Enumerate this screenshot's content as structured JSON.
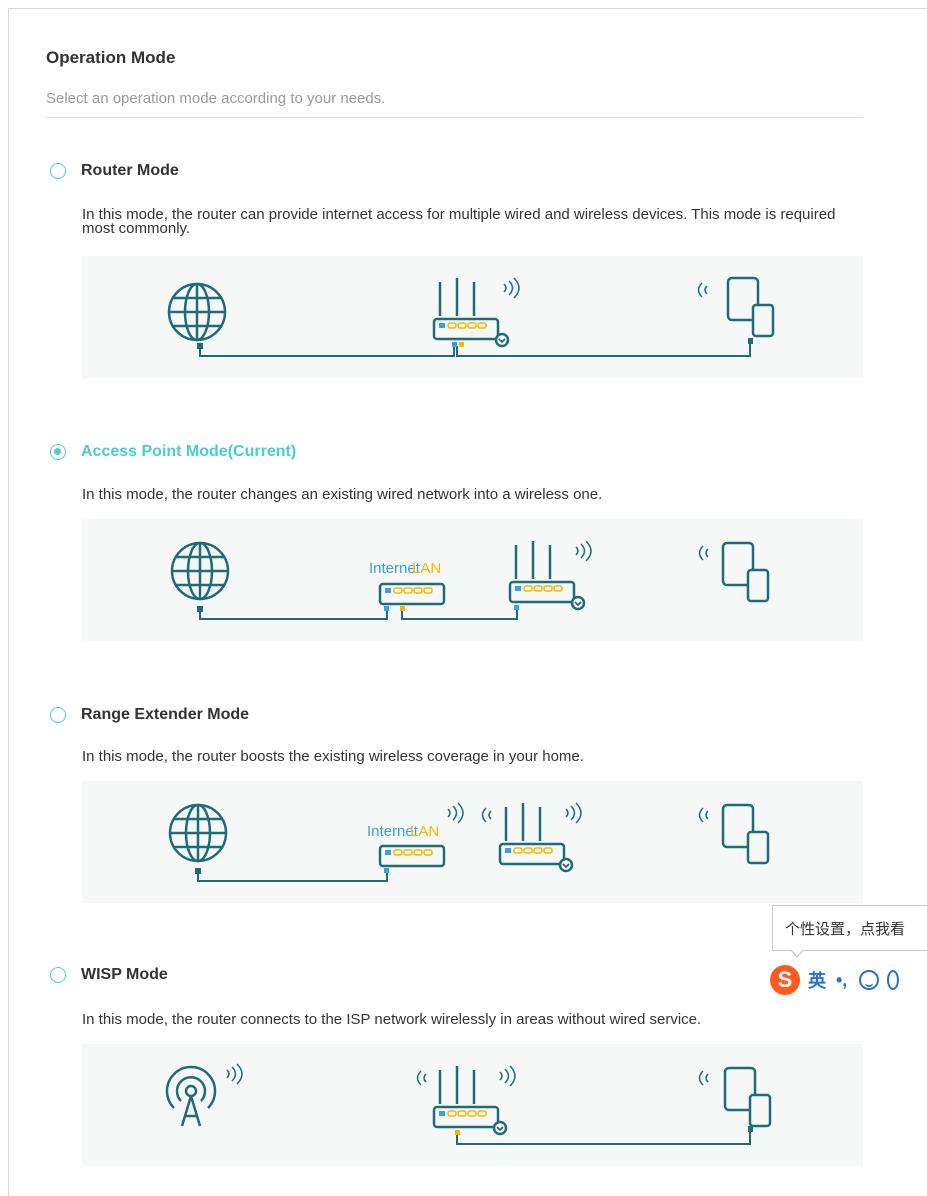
{
  "page": {
    "title": "Operation Mode",
    "subtitle": "Select an operation mode according to your needs."
  },
  "modes": [
    {
      "label": "Router Mode",
      "selected": false,
      "description": "In this mode, the router can provide internet access for multiple wired and wireless devices. This mode is required most commonly."
    },
    {
      "label": "Access Point Mode(Current)",
      "selected": true,
      "description": "In this mode, the router changes an existing wired network into a wireless one.",
      "diagram_labels": {
        "internet": "Internet",
        "lan": "LAN"
      }
    },
    {
      "label": "Range Extender Mode",
      "selected": false,
      "description": "In this mode, the router boosts the existing wireless coverage in your home.",
      "diagram_labels": {
        "internet": "Internet",
        "lan": "LAN"
      }
    },
    {
      "label": "WISP Mode",
      "selected": false,
      "description": "In this mode, the router connects to the ISP network wirelessly in areas without wired service."
    }
  ],
  "colors": {
    "accent": "#4acbd6",
    "icon": "#1f6b78",
    "port_blue": "#3aa0e0",
    "port_yellow": "#f5b800",
    "panel_bg": "#f6f8f8"
  },
  "ime": {
    "tooltip": "个性设置，点我看",
    "logo": "S",
    "lang": "英",
    "punct": "•,"
  }
}
